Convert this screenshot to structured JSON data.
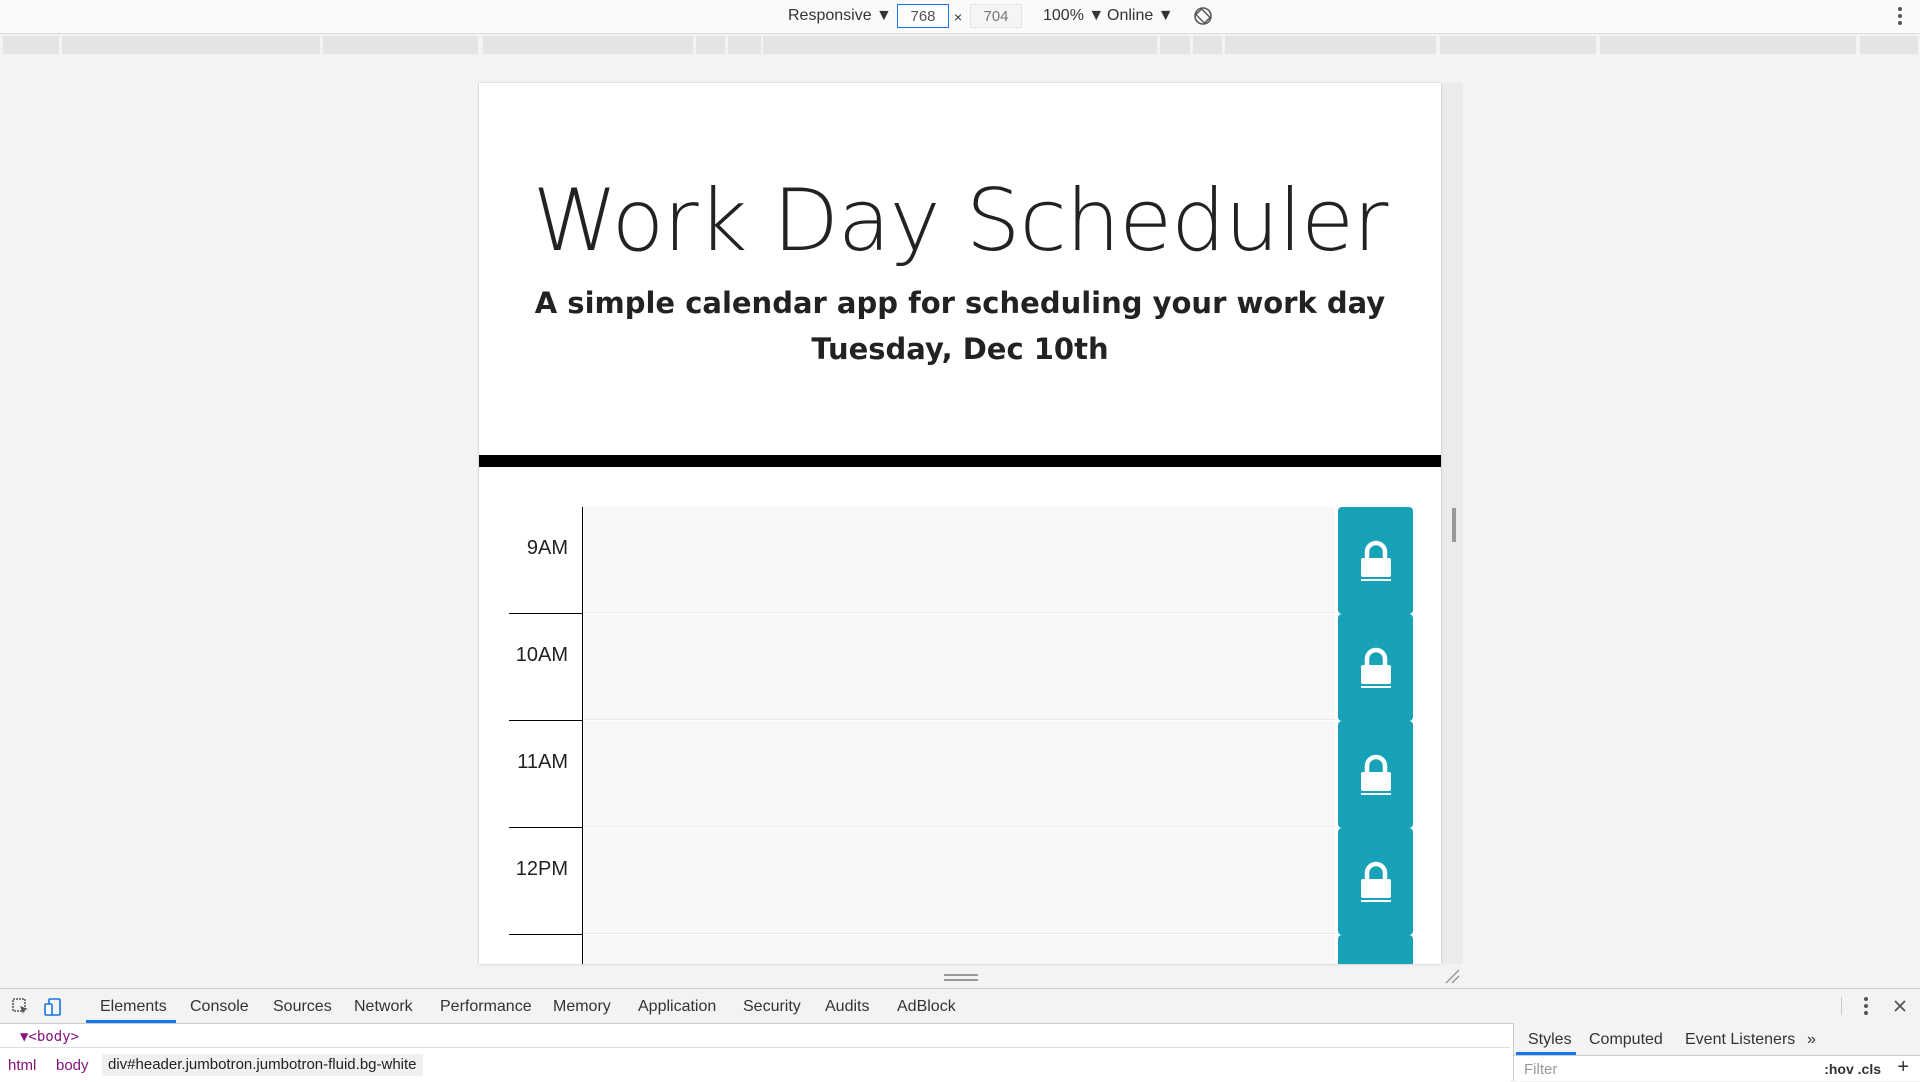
{
  "device_toolbar": {
    "device": "Responsive ▼",
    "width": "768",
    "times": "×",
    "height": "704",
    "zoom": "100% ▼",
    "network": "Online ▼"
  },
  "page": {
    "title": "Work Day Scheduler",
    "lead": "A simple calendar app for scheduling your work day",
    "date": "Tuesday, Dec 10th",
    "hours": [
      {
        "label": "9AM"
      },
      {
        "label": "10AM"
      },
      {
        "label": "11AM"
      },
      {
        "label": "12PM"
      }
    ],
    "colors": {
      "save_button": "#17a2b8",
      "divider": "#000000"
    }
  },
  "devtools": {
    "tabs": [
      "Elements",
      "Console",
      "Sources",
      "Network",
      "Performance",
      "Memory",
      "Application",
      "Security",
      "Audits",
      "AdBlock"
    ],
    "dom_line": "▼<body>",
    "breadcrumbs": [
      "html",
      "body",
      "div#header.jumbotron.jumbotron-fluid.bg-white"
    ],
    "styles_tabs": [
      "Styles",
      "Computed",
      "Event Listeners",
      "»"
    ],
    "filter_placeholder": "Filter",
    "hov_cls": ":hov  .cls",
    "plus": "+"
  }
}
